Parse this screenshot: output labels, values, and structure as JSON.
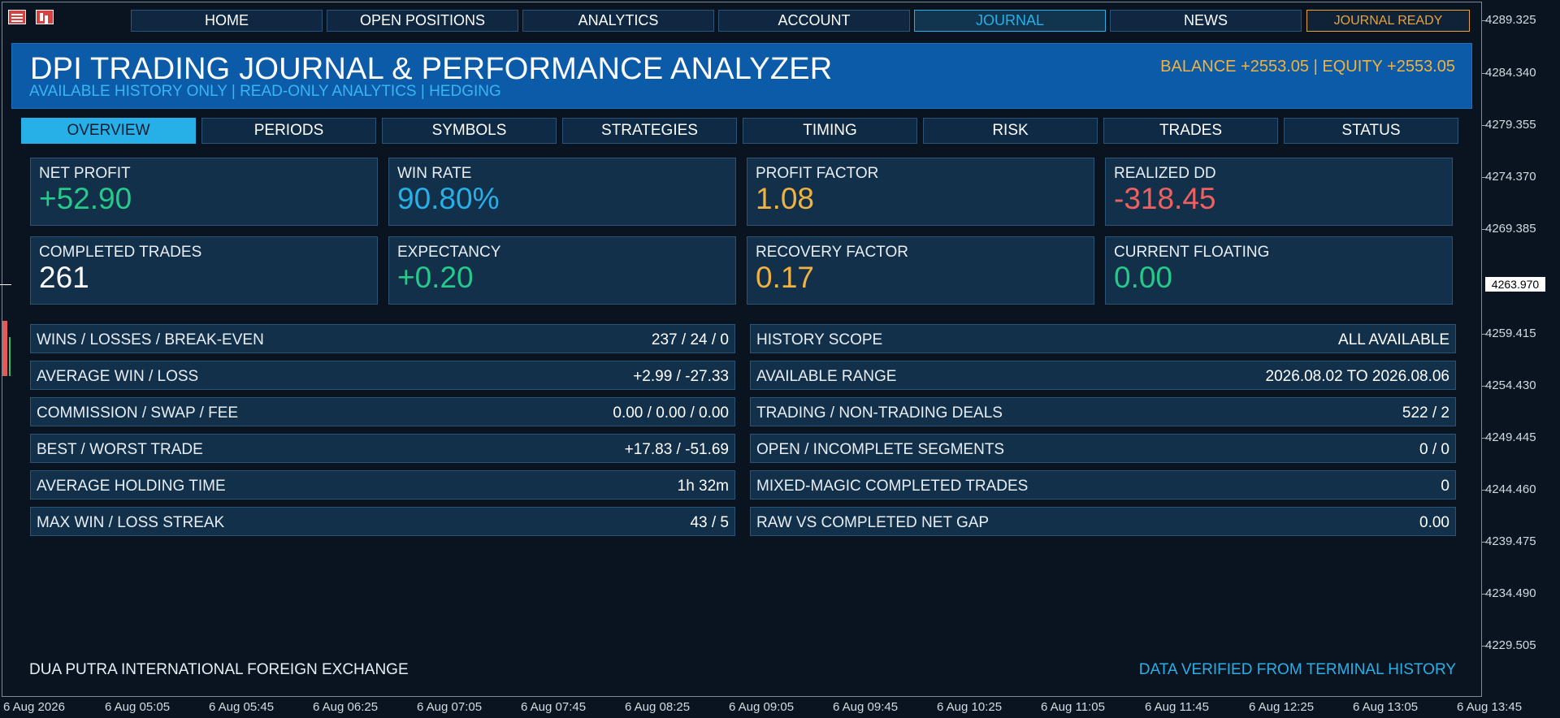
{
  "menu": {
    "items": [
      {
        "label": "HOME"
      },
      {
        "label": "OPEN POSITIONS"
      },
      {
        "label": "ANALYTICS"
      },
      {
        "label": "ACCOUNT"
      },
      {
        "label": "JOURNAL"
      },
      {
        "label": "NEWS"
      }
    ],
    "active": "JOURNAL",
    "status": "JOURNAL READY"
  },
  "header": {
    "title": "DPI TRADING JOURNAL & PERFORMANCE ANALYZER",
    "subtitle": "AVAILABLE HISTORY ONLY  |  READ-ONLY ANALYTICS  |  HEDGING",
    "balance": "BALANCE +2553.05  |  EQUITY +2553.05"
  },
  "tabs": {
    "items": [
      {
        "label": "OVERVIEW"
      },
      {
        "label": "PERIODS"
      },
      {
        "label": "SYMBOLS"
      },
      {
        "label": "STRATEGIES"
      },
      {
        "label": "TIMING"
      },
      {
        "label": "RISK"
      },
      {
        "label": "TRADES"
      },
      {
        "label": "STATUS"
      }
    ],
    "active": "OVERVIEW"
  },
  "cards": [
    {
      "label": "NET PROFIT",
      "value": "+52.90",
      "color": "#25c98a"
    },
    {
      "label": "WIN RATE",
      "value": "90.80%",
      "color": "#27b0e8"
    },
    {
      "label": "PROFIT FACTOR",
      "value": "1.08",
      "color": "#f0b240"
    },
    {
      "label": "REALIZED DD",
      "value": "-318.45",
      "color": "#f06060"
    },
    {
      "label": "COMPLETED TRADES",
      "value": "261",
      "color": "#ffffff"
    },
    {
      "label": "EXPECTANCY",
      "value": "+0.20",
      "color": "#25c98a"
    },
    {
      "label": "RECOVERY FACTOR",
      "value": "0.17",
      "color": "#f0b240"
    },
    {
      "label": "CURRENT FLOATING",
      "value": "0.00",
      "color": "#25c98a"
    }
  ],
  "left_rows": [
    {
      "label": "WINS / LOSSES / BREAK-EVEN",
      "value": "237 / 24 / 0"
    },
    {
      "label": "AVERAGE WIN / LOSS",
      "value": "+2.99 / -27.33"
    },
    {
      "label": "COMMISSION / SWAP / FEE",
      "value": "0.00 / 0.00 / 0.00"
    },
    {
      "label": "BEST / WORST TRADE",
      "value": "+17.83 / -51.69"
    },
    {
      "label": "AVERAGE HOLDING TIME",
      "value": "1h 32m"
    },
    {
      "label": "MAX WIN / LOSS STREAK",
      "value": "43 / 5"
    }
  ],
  "right_rows": [
    {
      "label": "HISTORY SCOPE",
      "value": "ALL AVAILABLE",
      "color": "#27b0e8"
    },
    {
      "label": "AVAILABLE RANGE",
      "value": "2026.08.02 TO 2026.08.06"
    },
    {
      "label": "TRADING / NON-TRADING DEALS",
      "value": "522 / 2"
    },
    {
      "label": "OPEN / INCOMPLETE SEGMENTS",
      "value": "0 / 0"
    },
    {
      "label": "MIXED-MAGIC COMPLETED TRADES",
      "value": "0"
    },
    {
      "label": "RAW VS COMPLETED NET GAP",
      "value": "0.00",
      "color": "#25c98a"
    }
  ],
  "footer": {
    "left": "DUA PUTRA INTERNATIONAL FOREIGN EXCHANGE",
    "right": "DATA VERIFIED FROM TERMINAL HISTORY"
  },
  "price_axis": {
    "labels": [
      "4289.325",
      "4284.340",
      "4279.355",
      "4274.370",
      "4269.385",
      "4263.970",
      "4259.415",
      "4254.430",
      "4249.445",
      "4244.460",
      "4239.475",
      "4234.490",
      "4229.505"
    ],
    "current": "4263.970"
  },
  "time_axis": {
    "labels": [
      "6 Aug 2026",
      "6 Aug 05:05",
      "6 Aug 05:45",
      "6 Aug 06:25",
      "6 Aug 07:05",
      "6 Aug 07:45",
      "6 Aug 08:25",
      "6 Aug 09:05",
      "6 Aug 09:45",
      "6 Aug 10:25",
      "6 Aug 11:05",
      "6 Aug 11:45",
      "6 Aug 12:25",
      "6 Aug 13:05",
      "6 Aug 13:45"
    ]
  },
  "colors": {
    "background": "#0a1420",
    "header": "#0b5ba8",
    "accent": "#27b0e8",
    "profit": "#25c98a",
    "loss": "#f06060",
    "warning": "#f0b240"
  }
}
